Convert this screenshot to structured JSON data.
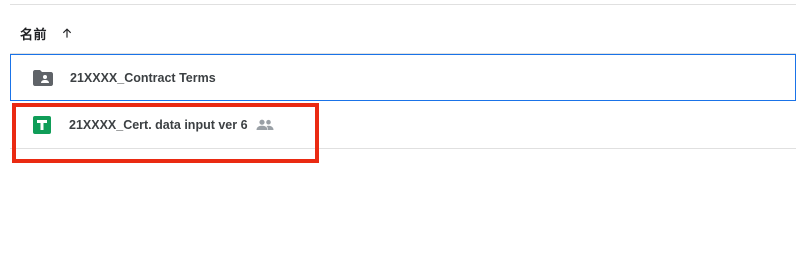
{
  "list": {
    "sort_header": {
      "label": "名前",
      "direction_icon": "arrow-up-icon"
    },
    "rows": [
      {
        "name": "21XXXX_Contract Terms",
        "icon": "shared-folder-icon",
        "selected": true
      },
      {
        "name": "21XXXX_Cert. data input ver 6",
        "icon": "google-sheets-icon",
        "shared_indicator": "people-icon",
        "highlighted": true
      }
    ]
  },
  "colors": {
    "selection_border": "#1a73e8",
    "highlight_box": "#ea2a12",
    "sheets_green": "#0f9d58",
    "folder_gray": "#5f6368",
    "shared_icon_gray": "#9aa0a6"
  }
}
